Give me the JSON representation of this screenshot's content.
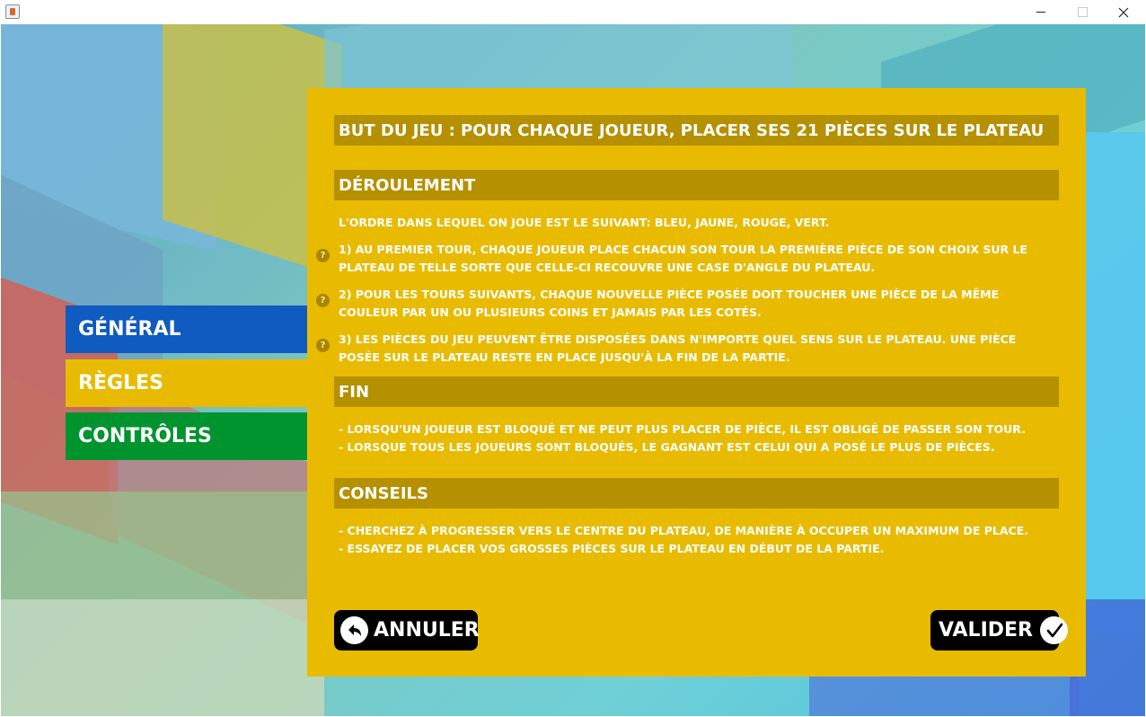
{
  "window": {
    "minimize_icon": "minimize-icon",
    "maximize_icon": "maximize-icon",
    "close_icon": "close-icon"
  },
  "sidebar": {
    "items": [
      {
        "label": "GÉNÉRAL",
        "color": "#0f5bbf"
      },
      {
        "label": "RÈGLES",
        "color": "#e8bb00"
      },
      {
        "label": "CONTRÔLES",
        "color": "#00942f"
      }
    ]
  },
  "panel": {
    "goal_title": "BUT DU JEU : POUR CHAQUE JOUEUR, PLACER SES 21 PIÈCES SUR LE PLATEAU",
    "deroulement": {
      "title": "DÉROULEMENT",
      "order": "L'ORDRE DANS LEQUEL ON JOUE EST LE SUIVANT: BLEU, JAUNE, ROUGE, VERT.",
      "rules": [
        "1) AU PREMIER TOUR, CHAQUE JOUEUR PLACE CHACUN SON TOUR LA PREMIÈRE PIÈCE DE SON CHOIX SUR LE PLATEAU DE TELLE SORTE QUE CELLE-CI RECOUVRE UNE CASE D'ANGLE DU PLATEAU.",
        "2) POUR LES TOURS SUIVANTS, CHAQUE NOUVELLE PIÈCE POSÉE DOIT TOUCHER UNE PIÈCE DE LA MÊME COULEUR PAR UN OU PLUSIEURS COINS ET JAMAIS PAR LES COTÉS.",
        "3) LES PIÈCES DU JEU PEUVENT ÊTRE DISPOSÉES DANS N'IMPORTE QUEL SENS SUR LE PLATEAU. UNE PIÈCE POSÉE SUR LE PLATEAU RESTE EN PLACE JUSQU'À LA FIN DE LA PARTIE."
      ],
      "help_glyph": "?"
    },
    "fin": {
      "title": "FIN",
      "lines": [
        "- LORSQU'UN JOUEUR EST BLOQUÉ ET NE PEUT PLUS PLACER DE PIÈCE, IL EST OBLIGÉ DE PASSER SON TOUR.",
        "- LORSQUE TOUS LES JOUEURS SONT BLOQUÉS, LE GAGNANT EST CELUI QUI A POSÉ LE PLUS DE PIÈCES."
      ]
    },
    "conseils": {
      "title": "CONSEILS",
      "lines": [
        "- CHERCHEZ À PROGRESSER VERS LE CENTRE DU PLATEAU, DE MANIÈRE À OCCUPER UN MAXIMUM DE PLACE.",
        "- ESSAYEZ DE PLACER VOS GROSSES PIÈCES SUR LE PLATEAU EN DÉBUT DE LA PARTIE."
      ]
    },
    "buttons": {
      "cancel_label": "ANNULER",
      "cancel_icon": "undo-arrow-icon",
      "validate_label": "VALIDER",
      "validate_icon": "checkmark-icon"
    }
  },
  "colors": {
    "panel": "#e8bb00",
    "section_header": "#b59000",
    "button": "#000000"
  }
}
